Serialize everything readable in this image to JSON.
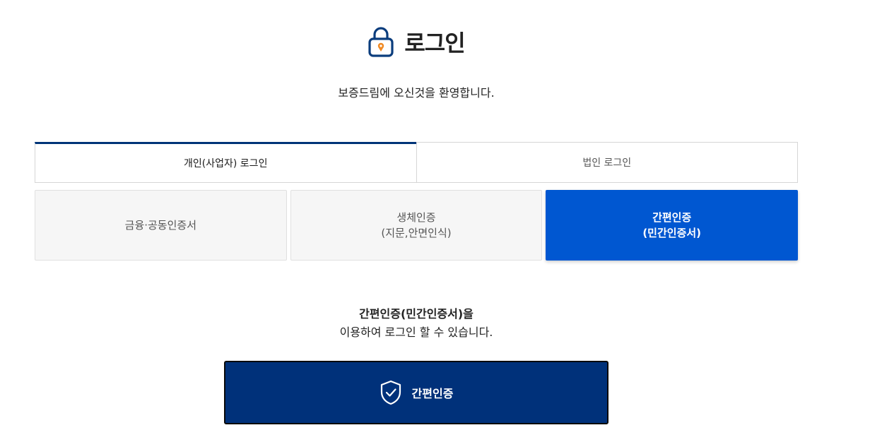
{
  "header": {
    "title": "로그인",
    "welcome": "보증드림에 오신것을 환영합니다.",
    "icon": "lock-icon"
  },
  "tabs": [
    {
      "label": "개인(사업자) 로그인",
      "active": true
    },
    {
      "label": "법인 로그인",
      "active": false
    }
  ],
  "methods": [
    {
      "line1": "금융·공동인증서",
      "line2": "",
      "selected": false
    },
    {
      "line1": "생체인증",
      "line2": "(지문,안면인식)",
      "selected": false
    },
    {
      "line1": "간편인증",
      "line2": "(민간인증서)",
      "selected": true
    }
  ],
  "description": {
    "strong": "간편인증(민간인증서)을",
    "normal": "이용하여 로그인 할 수 있습니다."
  },
  "auth_button": {
    "label": "간편인증",
    "icon": "shield-check-icon"
  },
  "colors": {
    "navy": "#003478",
    "selected_blue": "#0057d1",
    "button_bg": "#00317a",
    "lock_pin": "#f08a24"
  }
}
